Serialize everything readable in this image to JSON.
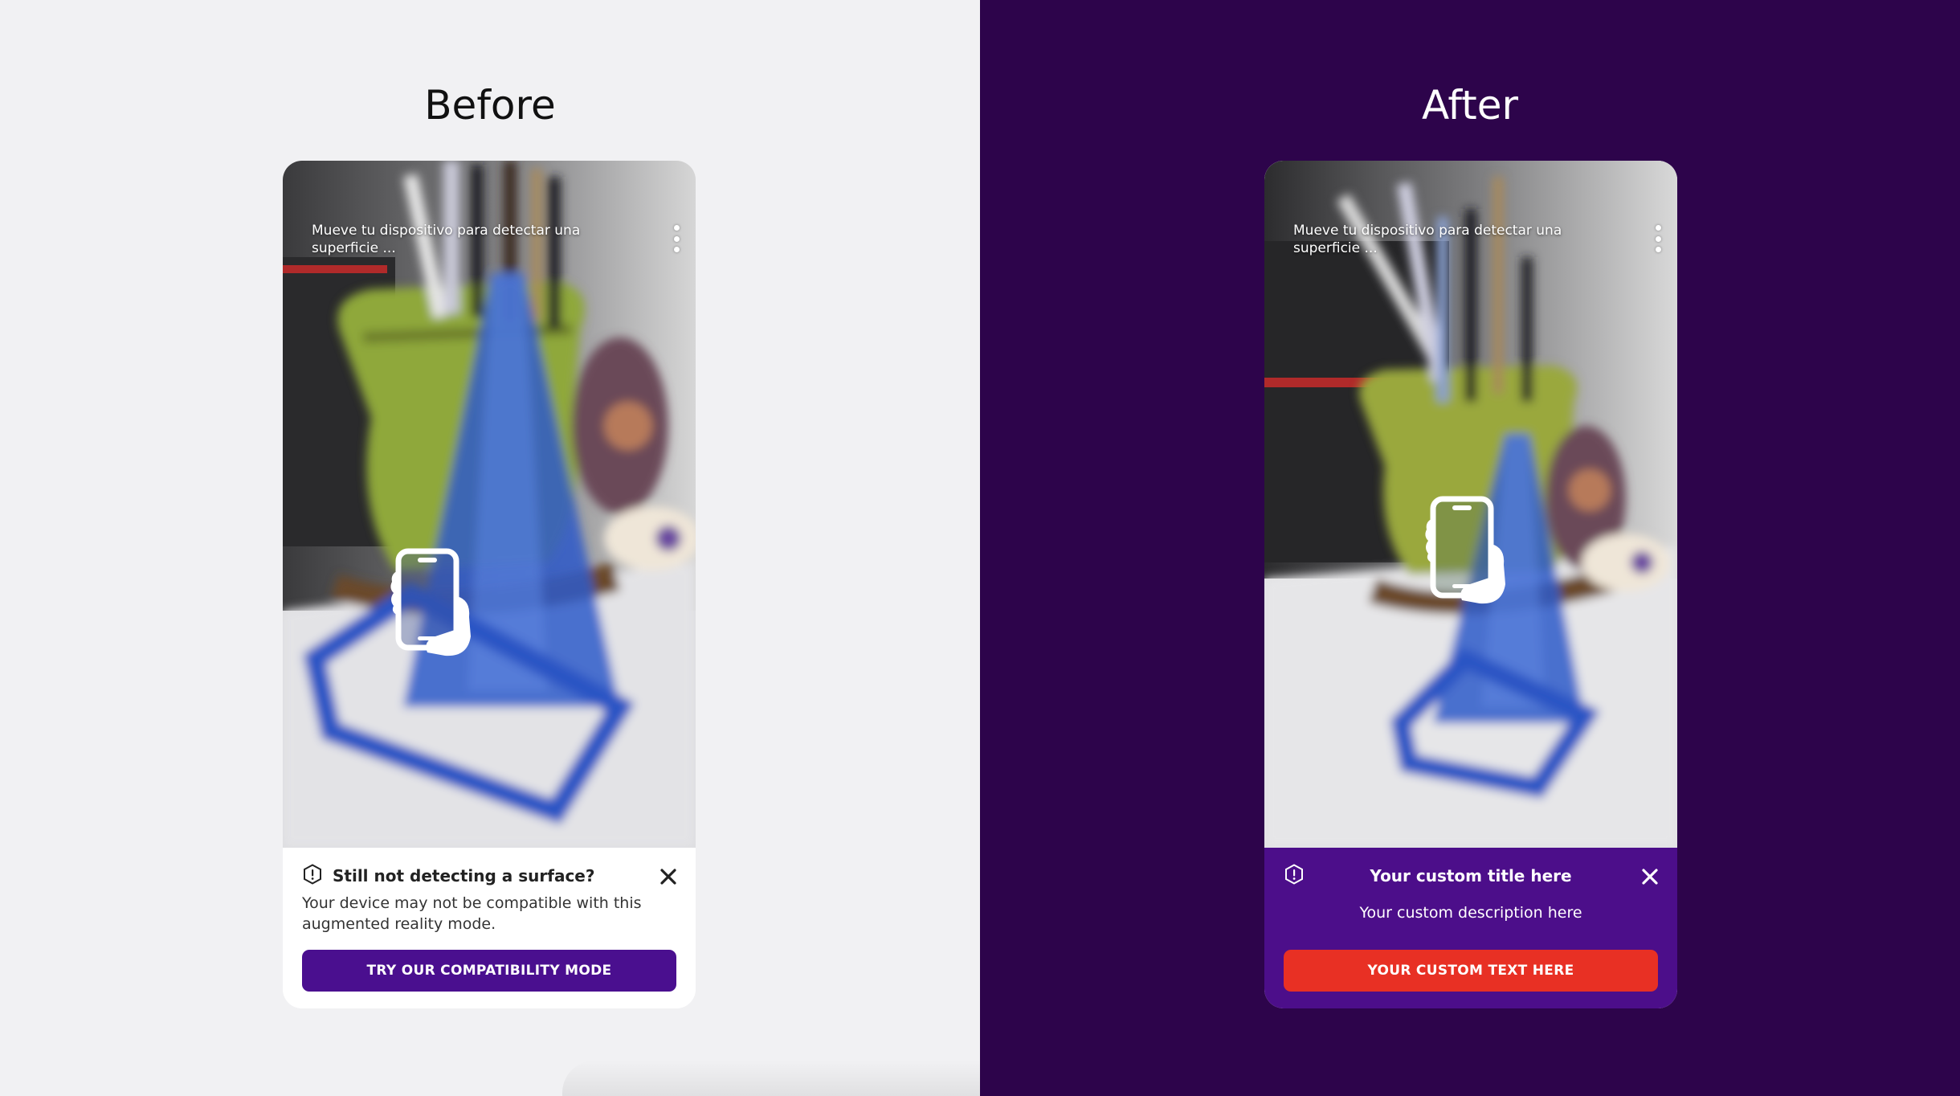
{
  "before": {
    "heading": "Before",
    "camera_hint": "Mueve tu dispositivo para detectar una superficie ...",
    "panel": {
      "title": "Still not detecting a surface?",
      "description": "Your device may not be compatible with this augmented reality mode.",
      "button_label": "TRY OUR COMPATIBILITY MODE"
    },
    "colors": {
      "background": "#f1f1f3",
      "panel": "#ffffff",
      "button": "#4a0f8f"
    }
  },
  "after": {
    "heading": "After",
    "camera_hint": "Mueve tu dispositivo para detectar una superficie ...",
    "panel": {
      "title": "Your custom title here",
      "description": "Your custom description here",
      "button_label": "YOUR CUSTOM TEXT HERE"
    },
    "colors": {
      "background": "#2d044b",
      "panel": "#4c0e8a",
      "button": "#e83024"
    }
  },
  "icons": {
    "menu": "more-vertical-icon",
    "warning": "warning-hexagon-icon",
    "close": "close-icon",
    "hand": "hand-holding-phone-icon"
  }
}
